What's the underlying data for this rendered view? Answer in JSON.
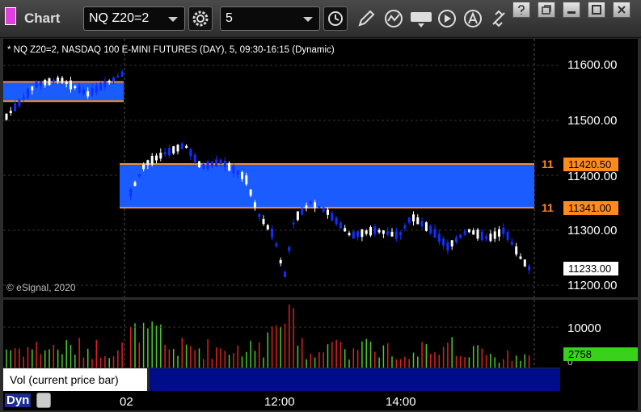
{
  "app": {
    "title": "Chart"
  },
  "toolbar": {
    "symbol_value": "NQ Z20=2",
    "interval_value": "5"
  },
  "chart": {
    "title": "* NQ Z20=2, NASDAQ 100 E-MINI FUTURES (DAY), 5, 09:30-16:15 (Dynamic)",
    "copyright": "© eSignal, 2020",
    "price_axis": [
      "11600.00",
      "11500.00",
      "11400.00",
      "11300.00",
      "11200.00"
    ],
    "level_upper": "11420.50",
    "level_lower": "11341.00",
    "level_prefix": "11",
    "last_price": "11233.00",
    "colors": {
      "up_candle": "#ffffff",
      "down_candle": "#1030ff",
      "zone": "#1a5cff",
      "level_line": "#ff8c28"
    }
  },
  "volume": {
    "axis_label": "10000",
    "axis_zero": "0",
    "last_value": "2758",
    "legend": "Vol (current price bar)",
    "colors": {
      "up": "#4ccc28",
      "down": "#e02020",
      "last_tag": "#39d11b"
    }
  },
  "timeaxis": {
    "labels": [
      "02",
      "12:00",
      "14:00"
    ],
    "dyn_label": "Dyn"
  }
}
